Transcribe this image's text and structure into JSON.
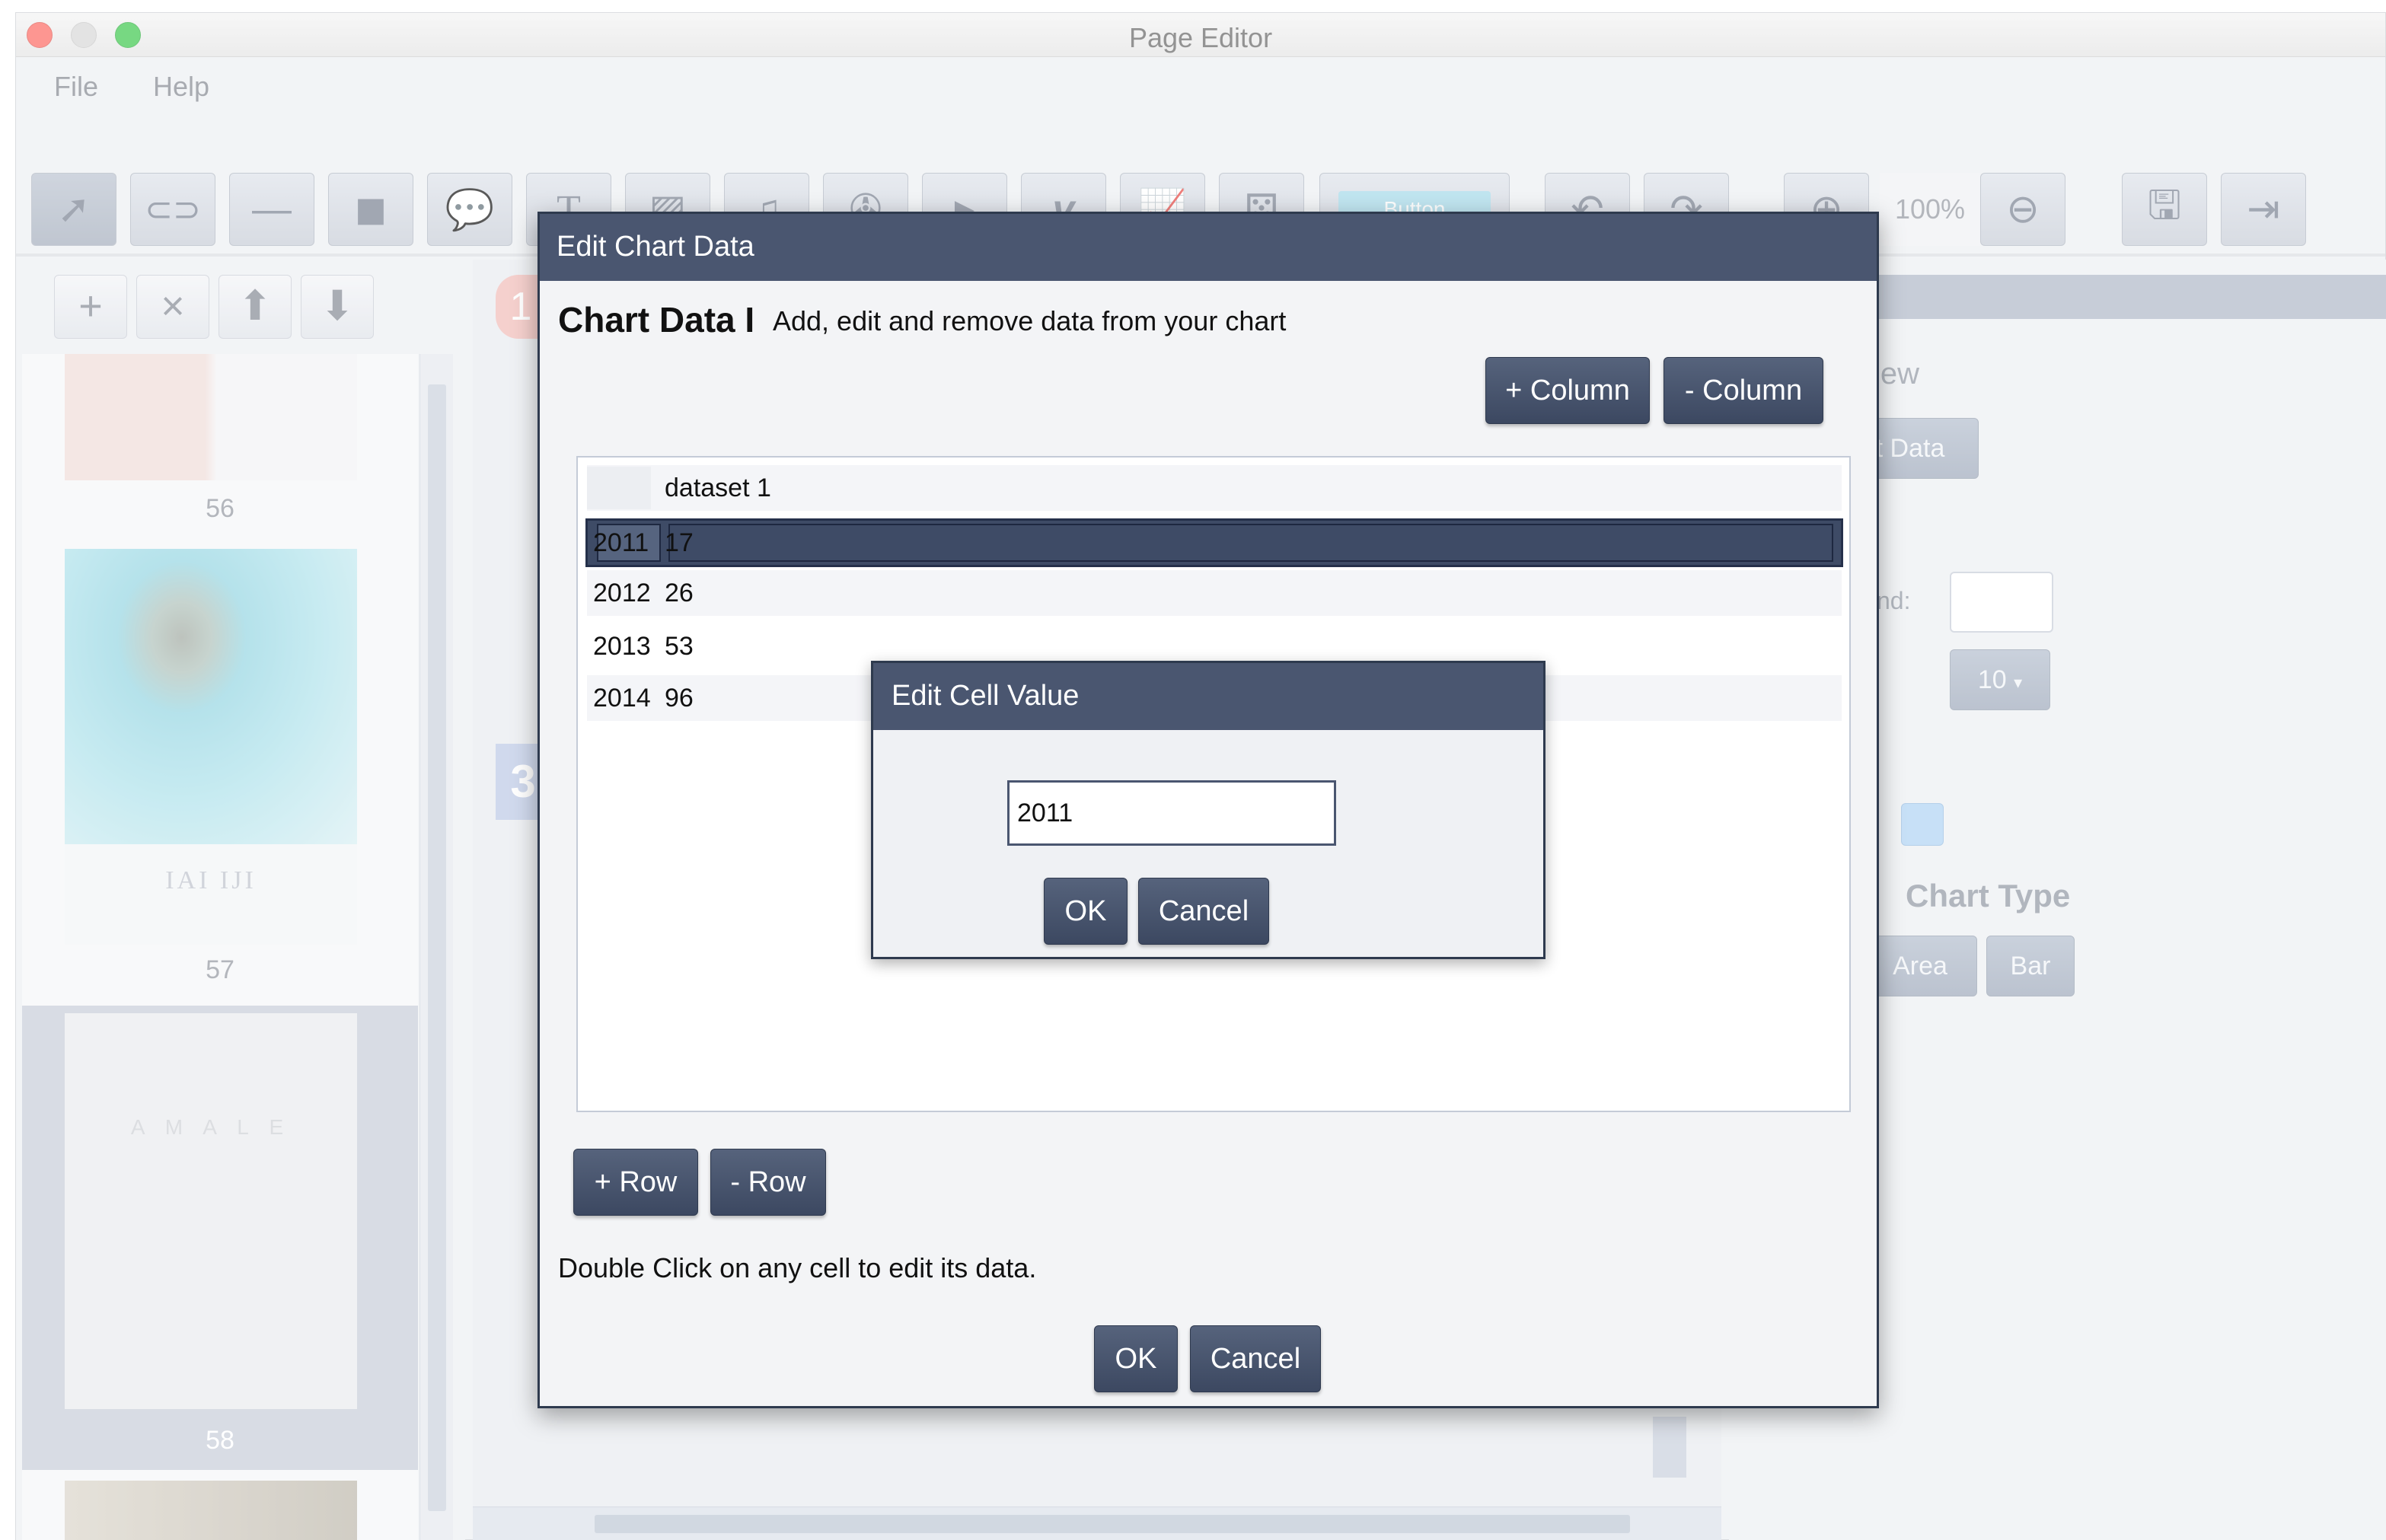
{
  "window": {
    "title": "Page Editor"
  },
  "menu": {
    "file": "File",
    "help": "Help"
  },
  "toolbar": {
    "button_label": "Button",
    "zoom_level": "100%"
  },
  "pages": [
    {
      "number": "56"
    },
    {
      "number": "57"
    },
    {
      "number": "58"
    }
  ],
  "canvas": {
    "badge_1": "1",
    "badge_3": "3"
  },
  "right_panel": {
    "view_fragment": "iew",
    "chart_data_fragment": "t Data",
    "label_fragment": "nd:",
    "size_select": "10",
    "chart_type_label": "Chart Type",
    "area_fragment": "Area",
    "bar_label": "Bar"
  },
  "chart_dialog": {
    "title": "Edit Chart Data",
    "heading": "Chart Data I",
    "subheading": "Add, edit and remove data from your chart",
    "add_column": "+ Column",
    "remove_column": "- Column",
    "add_row": "+ Row",
    "remove_row": "- Row",
    "help": "Double Click on any cell to edit its data.",
    "ok": "OK",
    "cancel": "Cancel",
    "table": {
      "header": [
        "",
        "dataset 1"
      ],
      "rows": [
        [
          "2011",
          "17"
        ],
        [
          "2012",
          "26"
        ],
        [
          "2013",
          "53"
        ],
        [
          "2014",
          "96"
        ]
      ]
    }
  },
  "cell_dialog": {
    "title": "Edit Cell Value",
    "value": "2011",
    "ok": "OK",
    "cancel": "Cancel"
  },
  "colors": {
    "dialog_titlebar": "#4a5670",
    "selected_row": "#3e4b66",
    "toolbar_button": "#c3c9d4",
    "swatch": "#a9d0f3"
  }
}
